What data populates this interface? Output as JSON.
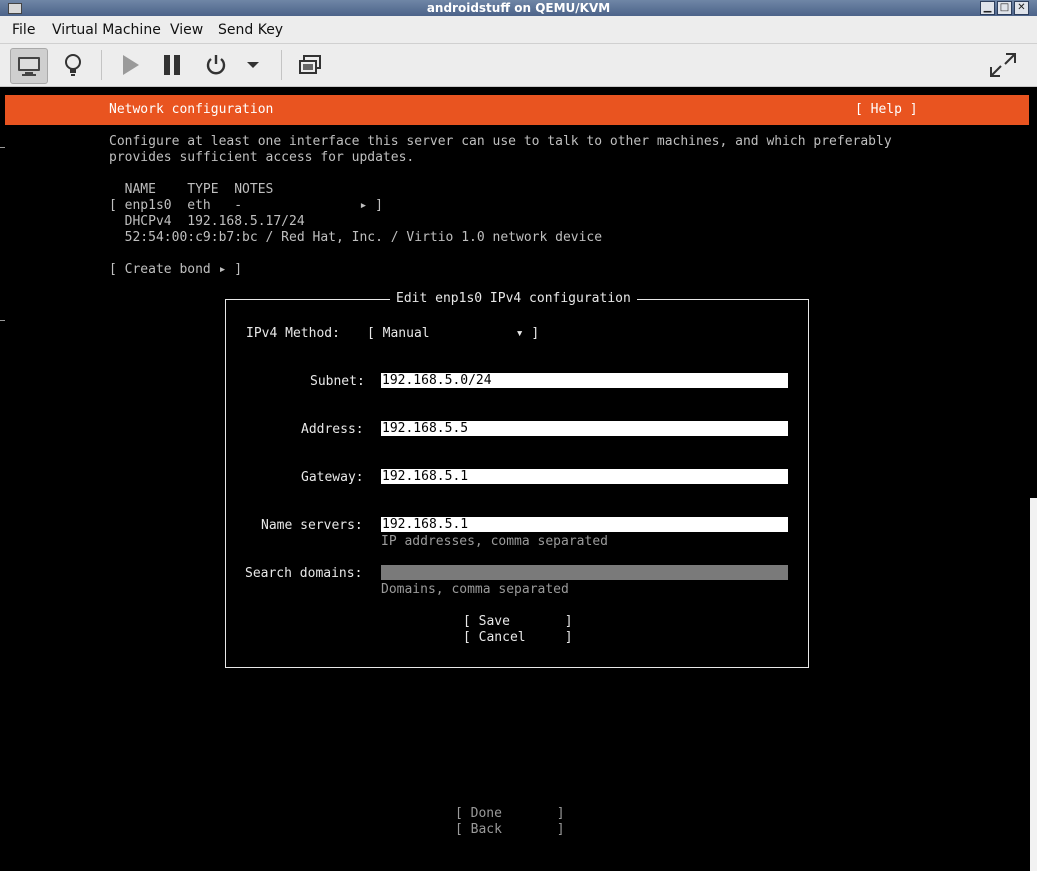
{
  "window": {
    "title": "androidstuff on QEMU/KVM",
    "minimize": "▁",
    "maximize": "□",
    "close": "✕"
  },
  "menu": {
    "file": "File",
    "vm": "Virtual Machine",
    "view": "View",
    "sendkey": "Send Key"
  },
  "toolbar": {
    "icons": [
      "monitor-icon",
      "bulb-icon",
      "play-icon",
      "pause-icon",
      "power-icon",
      "dropdown-arrow-icon",
      "screenshot-icon",
      "fullscreen-icon"
    ]
  },
  "header": {
    "title": "Network configuration",
    "help": "[ Help ]"
  },
  "intro": {
    "line1": "Configure at least one interface this server can use to talk to other machines, and which preferably",
    "line2": "provides sufficient access for updates."
  },
  "table": {
    "header": "  NAME    TYPE  NOTES",
    "row": "[ enp1s0  eth   -               ▸ ]",
    "dhcp": "  DHCPv4  192.168.5.17/24",
    "mac": "  52:54:00:c9:b7:bc / Red Hat, Inc. / Virtio 1.0 network device"
  },
  "create_bond": "[ Create bond ▸ ]",
  "dialog": {
    "title": "Edit enp1s0 IPv4 configuration",
    "method_label": "IPv4 Method:",
    "method_value": "[ Manual           ▾ ]",
    "subnet_label": "Subnet:",
    "subnet_value": "192.168.5.0/24",
    "address_label": "Address:",
    "address_value": "192.168.5.5",
    "gateway_label": "Gateway:",
    "gateway_value": "192.168.5.1",
    "ns_label": "Name servers:",
    "ns_value": "192.168.5.1",
    "ns_hint": "IP addresses, comma separated",
    "sd_label": "Search domains:",
    "sd_value": "",
    "sd_hint": "Domains, comma separated",
    "save": "[ Save       ]",
    "cancel": "[ Cancel     ]"
  },
  "footer": {
    "done": "[ Done       ]",
    "back": "[ Back       ]"
  },
  "colors": {
    "accent": "#e95420",
    "titlebar": "#5a7093"
  }
}
